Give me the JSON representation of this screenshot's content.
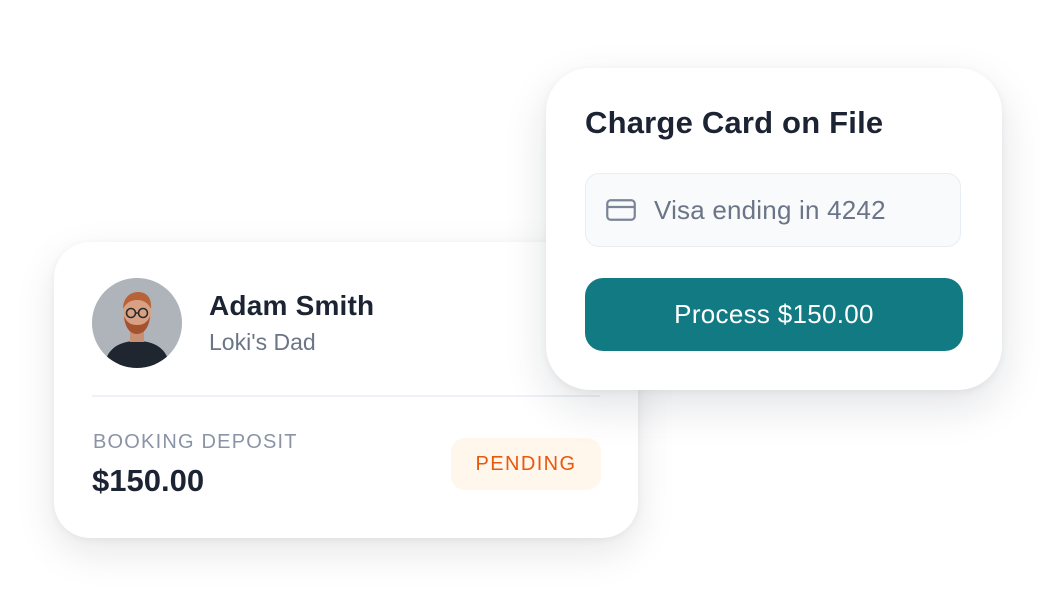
{
  "client_card": {
    "name": "Adam Smith",
    "relation": "Loki's Dad",
    "deposit_label": "BOOKING DEPOSIT",
    "deposit_amount": "$150.00",
    "status": "PENDING"
  },
  "charge_card": {
    "title": "Charge Card on File",
    "card_field": {
      "icon": "credit-card-icon",
      "text": "Visa ending in 4242"
    },
    "process_button_label": "Process $150.00"
  },
  "colors": {
    "primary_text": "#1c2434",
    "secondary_text": "#6b7587",
    "muted_label": "#8a94a6",
    "button": "#127a83",
    "pending_text": "#ea580c",
    "pending_background": "#fff6ec",
    "field_background": "#f8fafc"
  }
}
